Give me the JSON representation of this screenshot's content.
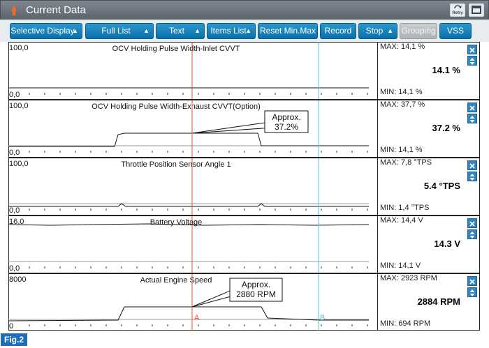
{
  "window": {
    "title": "Current Data",
    "retry_label": "Retry"
  },
  "toolbar": {
    "buttons": [
      {
        "label": "Selective Display",
        "has_arrow": true,
        "disabled": false
      },
      {
        "label": "Full List",
        "has_arrow": true,
        "disabled": false
      },
      {
        "label": "Text",
        "has_arrow": true,
        "disabled": false
      },
      {
        "label": "Items List",
        "has_arrow": true,
        "disabled": false
      },
      {
        "label": "Reset Min.Max",
        "has_arrow": false,
        "disabled": false
      },
      {
        "label": "Record",
        "has_arrow": false,
        "disabled": false
      },
      {
        "label": "Stop",
        "has_arrow": true,
        "disabled": false
      },
      {
        "label": "Grouping",
        "has_arrow": false,
        "disabled": true
      },
      {
        "label": "VSS",
        "has_arrow": false,
        "disabled": false
      }
    ]
  },
  "cursors": {
    "a_label": "A",
    "b_label": "B",
    "a_color": "#e0522c",
    "b_color": "#4fc3c9"
  },
  "panels": [
    {
      "name": "OCV Holding Pulse Width-Inlet CVVT",
      "ymax_label": "100,0",
      "ymin_label": "0,0",
      "max": "MAX:  14,1 %",
      "min": "MIN:  14,1 %",
      "current": "14.1 %"
    },
    {
      "name": "OCV Holding Pulse Width-Exhaust CVVT(Option)",
      "ymax_label": "100,0",
      "ymin_label": "0,0",
      "max": "MAX:  37,7 %",
      "min": "MIN:  14,1 %",
      "current": "37.2 %",
      "callout": [
        "Approx.",
        "37.2%"
      ]
    },
    {
      "name": "Throttle Position Sensor Angle 1",
      "ymax_label": "100,0",
      "ymin_label": "0,0",
      "max": "MAX:    7,8 °TPS",
      "min": "MIN:  1,4 °TPS",
      "current": "5.4 °TPS"
    },
    {
      "name": "Battery Voltage",
      "ymax_label": "16,0",
      "ymin_label": "0,0",
      "max": "MAX:  14,4 V",
      "min": "MIN:  14,1 V",
      "current": "14.3 V"
    },
    {
      "name": "Actual Engine Speed",
      "ymax_label": "8000",
      "ymin_label": "0",
      "max": "MAX:  2923 RPM",
      "min": "MIN:   694 RPM",
      "current": "2884 RPM",
      "callout": [
        "Approx.",
        "2880 RPM"
      ]
    }
  ],
  "figure_label": "Fig.2"
}
